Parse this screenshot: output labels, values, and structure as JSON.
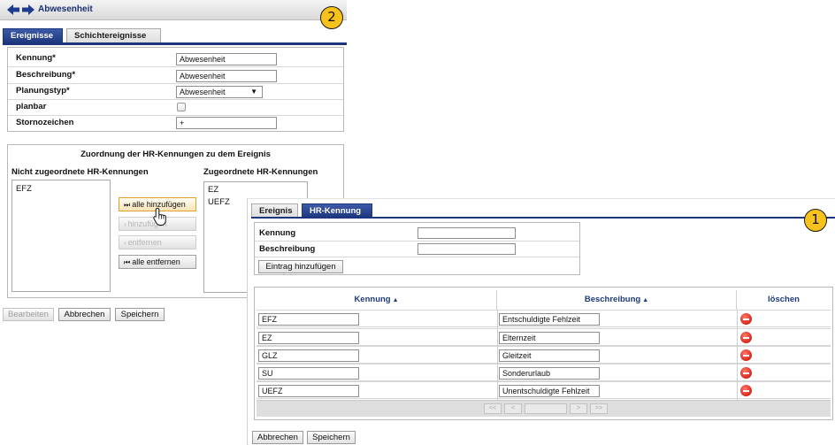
{
  "back_window": {
    "badge": "2",
    "title": "Abwesenheit",
    "tabs": [
      {
        "label": "Ereignisse",
        "active": true
      },
      {
        "label": "Schichtereignisse",
        "active": false
      }
    ],
    "form": {
      "kennung_label": "Kennung*",
      "kennung_value": "Abwesenheit",
      "beschreibung_label": "Beschreibung*",
      "beschreibung_value": "Abwesenheit",
      "planungstyp_label": "Planungstyp*",
      "planungstyp_value": "Abwesenheit",
      "planbar_label": "planbar",
      "planbar_checked": false,
      "stornozeichen_label": "Stornozeichen",
      "stornozeichen_value": "+"
    },
    "hr": {
      "header": "Zuordnung der HR-Kennungen zu dem Ereignis",
      "unassigned_label": "Nicht zugeordnete HR-Kennungen",
      "unassigned_items": [
        "EFZ"
      ],
      "assigned_label": "Zugeordnete HR-Kennungen",
      "assigned_items": [
        "EZ",
        "UEFZ"
      ],
      "btn_add_all": "alle hinzufügen",
      "btn_add": "hinzufügen",
      "btn_remove": "entfernen",
      "btn_remove_all": "alle entfernen"
    },
    "buttons": {
      "edit": "Bearbeiten",
      "cancel": "Abbrechen",
      "save": "Speichern"
    }
  },
  "front_window": {
    "badge": "1",
    "tabs": [
      {
        "label": "Ereignis",
        "active": false
      },
      {
        "label": "HR-Kennung",
        "active": true
      }
    ],
    "form": {
      "kennung_label": "Kennung",
      "kennung_value": "",
      "beschreibung_label": "Beschreibung",
      "beschreibung_value": "",
      "add_entry": "Eintrag hinzufügen"
    },
    "table": {
      "col_kennung": "Kennung",
      "col_beschreibung": "Beschreibung",
      "col_loeschen": "löschen",
      "rows": [
        {
          "kennung": "EFZ",
          "beschreibung": "Entschuldigte Fehlzeit"
        },
        {
          "kennung": "EZ",
          "beschreibung": "Elternzeit"
        },
        {
          "kennung": "GLZ",
          "beschreibung": "Gleitzeit"
        },
        {
          "kennung": "SU",
          "beschreibung": "Sonderurlaub"
        },
        {
          "kennung": "UEFZ",
          "beschreibung": "Unentschuldigte Fehlzeit"
        }
      ],
      "pager": [
        "<<",
        "<",
        "",
        ">",
        ">>"
      ]
    },
    "buttons": {
      "cancel": "Abbrechen",
      "save": "Speichern"
    }
  },
  "colors": {
    "badge": "#f7c21b",
    "tab_active": "#1d357c",
    "header_text": "#1e3a7b",
    "delete": "#d5261a"
  }
}
